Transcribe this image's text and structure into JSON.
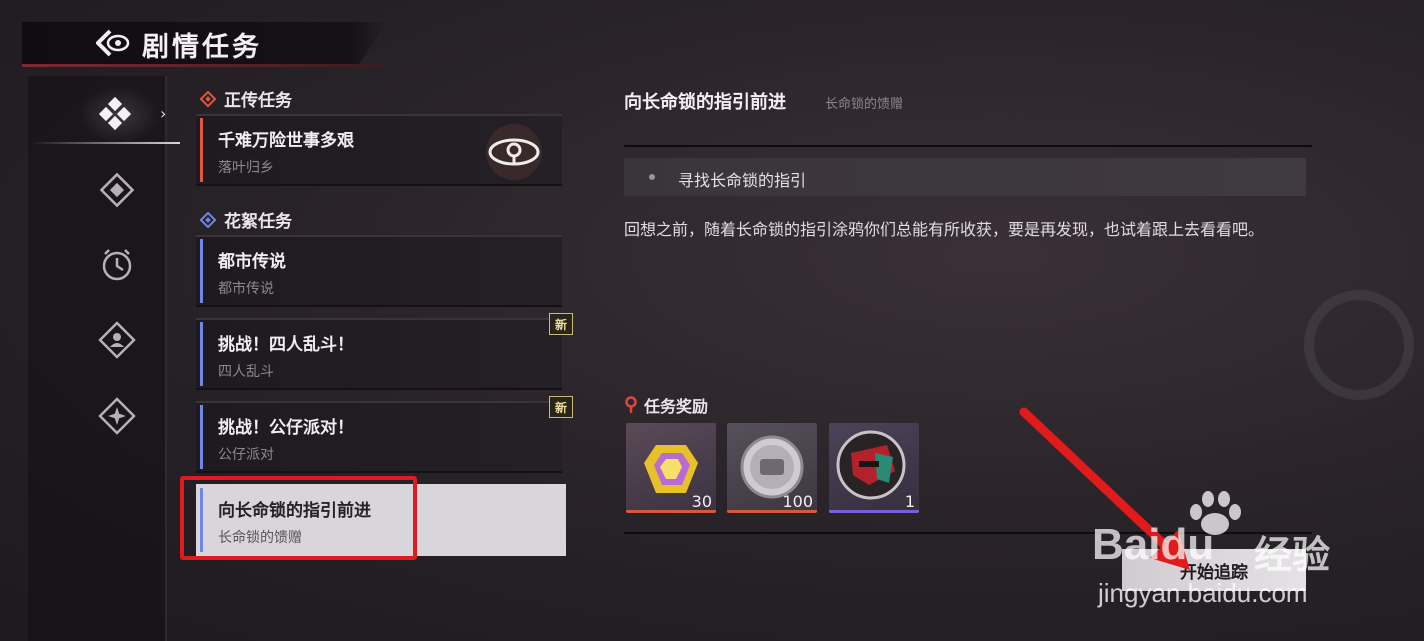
{
  "header": {
    "title": "剧情任务",
    "back_icon": "back-eye-icon"
  },
  "rail": {
    "items": [
      {
        "icon": "main-story-icon",
        "active": true
      },
      {
        "icon": "diamond-icon"
      },
      {
        "icon": "clock-icon"
      },
      {
        "icon": "person-diamond-icon"
      },
      {
        "icon": "star-diamond-icon"
      }
    ]
  },
  "sections": [
    {
      "label": "正传任务",
      "color": "#e0573f"
    },
    {
      "label": "花絮任务",
      "color": "#6f86e6"
    }
  ],
  "quests": [
    {
      "title": "千难万险世事多艰",
      "subtitle": "落叶归乡",
      "accent": "#e0573f",
      "is_new": false,
      "selected": false
    },
    {
      "title": "都市传说",
      "subtitle": "都市传说",
      "accent": "#6f86e6",
      "is_new": false,
      "selected": false
    },
    {
      "title": "挑战！四人乱斗！",
      "subtitle": "四人乱斗",
      "accent": "#6f86e6",
      "is_new": true,
      "selected": false
    },
    {
      "title": "挑战！公仔派对！",
      "subtitle": "公仔派对",
      "accent": "#6f86e6",
      "is_new": true,
      "selected": false
    },
    {
      "title": "向长命锁的指引前进",
      "subtitle": "长命锁的馈赠",
      "accent": "#6f86e6",
      "is_new": false,
      "selected": true
    }
  ],
  "new_badge": "新",
  "detail": {
    "title": "向长命锁的指引前进",
    "subtitle": "长命锁的馈赠",
    "objective": "寻找长命锁的指引",
    "description": "回想之前，随着长命锁的指引涂鸦你们总能有所收获，要是再发现，也试着跟上去看看吧。",
    "reward_heading": "任务奖励",
    "rewards": [
      {
        "icon": "polychrome-gem-icon",
        "amount": "30",
        "rarity_color": "#d9573e"
      },
      {
        "icon": "silver-coin-icon",
        "amount": "100",
        "rarity_color": "#d9573e"
      },
      {
        "icon": "avatar-badge-icon",
        "amount": "1",
        "rarity_color": "#7a5fd6"
      }
    ],
    "track_button": "开始追踪"
  },
  "watermark": {
    "brand": "Baidu",
    "brand_cn": "经验",
    "url": "jingyan.baidu.com"
  },
  "colors": {
    "highlight": "#e11b1b",
    "arrow": "#e11b1b"
  }
}
